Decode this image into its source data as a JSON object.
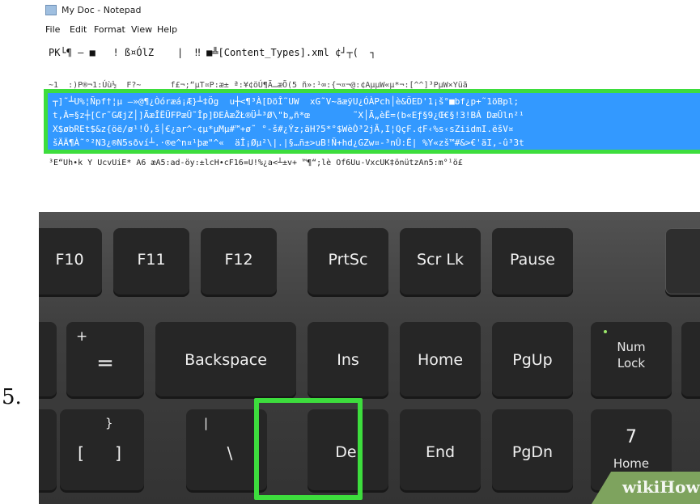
{
  "step": {
    "number": "5."
  },
  "notepad": {
    "title": "My Doc - Notepad",
    "menu": [
      "File",
      "Edit",
      "Format",
      "View",
      "Help"
    ],
    "line1": "PK└¶ – ■   ! ß¤ÓlZ    |  ‼ ■╩[Content_Types].xml ¢┘┬(  ┐",
    "line2": "~1  :)P®¬1:Úù½  F?~      f£¬;“µT¤P:æ±_ª:­¥¢öÚ¶Ã…æÕ(5 ñ»:¹∞:{¬¤¬@:¢AµµW«µ*¬:[^^]³PµW×Yüã",
    "selected": [
      "┬]˜┴U%¦Ñpf†¦µ –»@¶¿Òóræá¡Æ}┴‡Ög  u┼<¶³À[DöÎ˜UW  xG˜V~ãæÿU¿ÓÀPch│è&ÖED'1¡š°■bf¿p+˜1öBpl;",
      "t,À=§z┼[Cr˜GÆjZ│]ÃæÎËÜFPæÛ˜Îp]ÐEÀæŽŁ®Ü┴³Ø\\\"b„ñ*œ        ˜X│Ã„èË=(b«Eƒ§9¿Œ€§!3!BÁ DæÛln²¹",
      "X$øbREt$&z{öë/ø¹!Ö,š│€¿ar^-¢µ*µMµ#™+ø˜ °-š#¿Ýz;äH?5*°$WèÒ³2jÃ,I¦QçF.¢F‹%s‹sZiidmI.ëšV¤",
      "šÄÄ¶À˜°²N3¿®N5sðví┴.·®e^n¤¹þæ\"^«  äÎ¡Øµ²\\|.|§…ñ±>uB!Ñ+hd¿GZw¤-³nÛ:Ë| %Y«zš™#&>€'äI,-û³3t"
    ],
    "line7": "³E“Uh•k Y UcvUiE* A6 æA5:ad-öy:±lcH•cF16=U!%¿a<┴±v+ ™¶“;lè Of6Uu-VxcUK‡önützAn5:m°¹ö£"
  },
  "keyboard": {
    "row1": [
      "F10",
      "F11",
      "F12",
      "PrtSc",
      "Scr Lk",
      "Pause"
    ],
    "row2": [
      "Backspace",
      "Ins",
      "Home",
      "PgUp",
      "Num",
      "Lock"
    ],
    "row2_equals": {
      "top": "+",
      "main": "="
    },
    "row3": [
      "[",
      "]",
      "\\",
      "Del",
      "End",
      "PgDn",
      "7",
      "Home"
    ],
    "row3_marks": {
      "brace": "}",
      "pipe": "|"
    }
  },
  "watermark": "wikiHow",
  "colors": {
    "selection": "#3399ff",
    "highlight": "#3ddd3d",
    "key": "#262626"
  }
}
